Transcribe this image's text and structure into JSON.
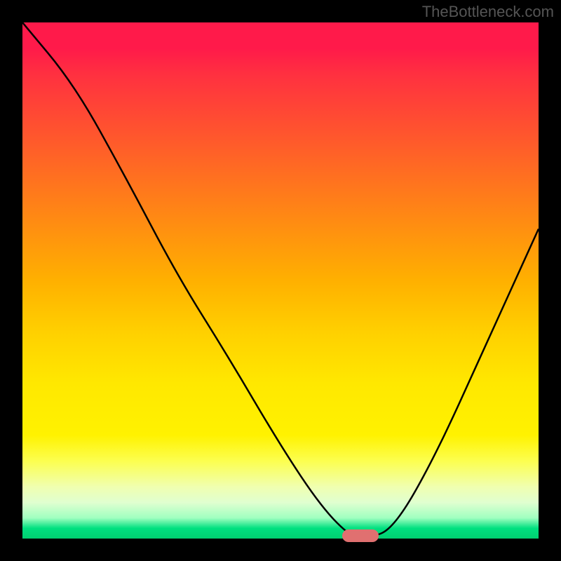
{
  "watermark": "TheBottleneck.com",
  "chart_data": {
    "type": "line",
    "title": "",
    "xlabel": "",
    "ylabel": "",
    "xlim": [
      0,
      100
    ],
    "ylim": [
      0,
      100
    ],
    "background_gradient": {
      "top": "#ff1a4a",
      "mid": "#ffd000",
      "bottom": "#00d070",
      "note": "Vertical gradient red→yellow→green representing bottleneck severity (top=worst, bottom=best)"
    },
    "series": [
      {
        "name": "bottleneck-curve",
        "x": [
          0,
          10,
          20,
          30,
          40,
          50,
          58,
          64,
          67,
          72,
          80,
          90,
          100
        ],
        "values": [
          100,
          88,
          70,
          51,
          35,
          18,
          6,
          0,
          0,
          2,
          16,
          38,
          60
        ]
      }
    ],
    "marker": {
      "name": "optimal-range",
      "x_center": 65.5,
      "y": 0,
      "width_pct": 7,
      "color": "#e07070"
    }
  }
}
